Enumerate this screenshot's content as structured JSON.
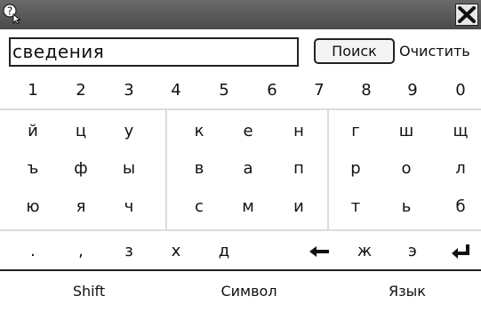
{
  "title_bar": {
    "help_icon": "help-cursor-icon",
    "close_icon": "close-x-icon"
  },
  "search": {
    "value": "сведения",
    "search_button": "Поиск",
    "clear_button": "Очистить"
  },
  "keyboard": {
    "digits": [
      "1",
      "2",
      "3",
      "4",
      "5",
      "6",
      "7",
      "8",
      "9",
      "0"
    ],
    "row1": [
      "й",
      "ц",
      "у",
      "к",
      "е",
      "н",
      "г",
      "ш",
      "щ"
    ],
    "row2": [
      "ъ",
      "ф",
      "ы",
      "в",
      "а",
      "п",
      "р",
      "о",
      "л"
    ],
    "row3": [
      "ю",
      "я",
      "ч",
      "с",
      "м",
      "и",
      "т",
      "ь",
      "б"
    ],
    "row4": [
      ".",
      ",",
      "з",
      "х",
      "д",
      "ж",
      "э"
    ],
    "backspace_icon": "backspace-arrow-icon",
    "enter_icon": "enter-return-icon",
    "function_keys": [
      "Shift",
      "Символ",
      "Язык"
    ]
  }
}
